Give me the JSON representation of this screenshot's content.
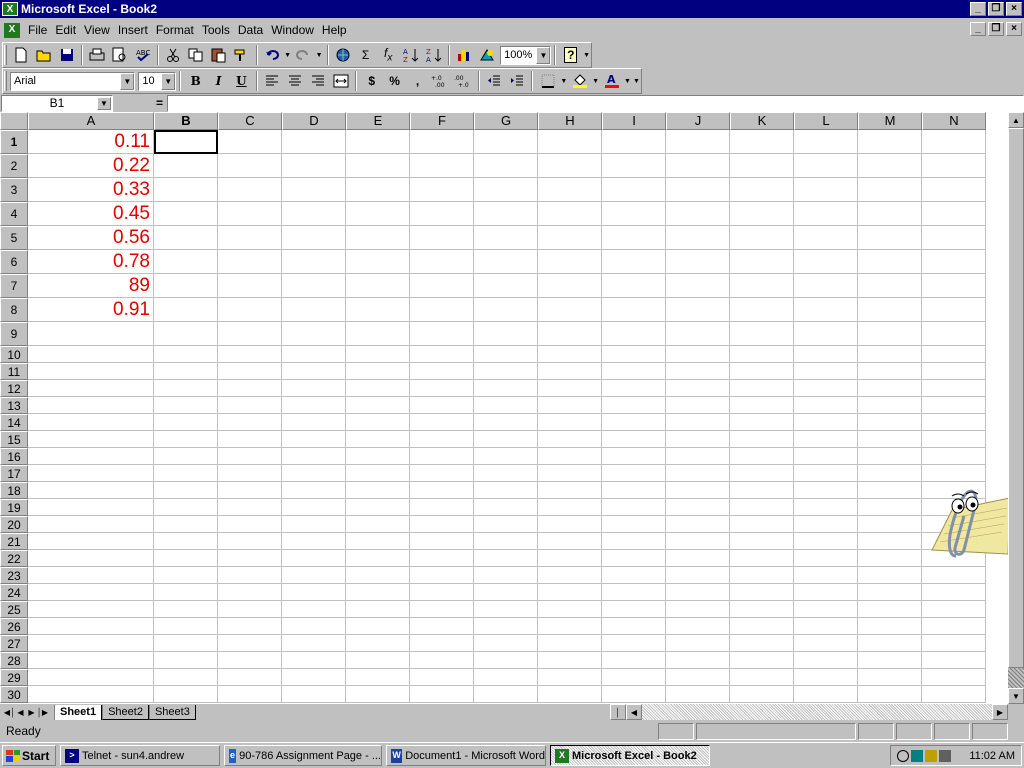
{
  "window": {
    "title": "Microsoft Excel - Book2",
    "buttons": [
      "_",
      "❏",
      "×"
    ]
  },
  "menu": {
    "items": [
      "File",
      "Edit",
      "View",
      "Insert",
      "Format",
      "Tools",
      "Data",
      "Window",
      "Help"
    ]
  },
  "toolbar": {
    "zoom": "100%",
    "font_name": "Arial",
    "font_size": "10",
    "bold": "B",
    "italic": "I",
    "underline": "U",
    "currency": "$",
    "percent": "%",
    "comma": ",",
    "sum": "Σ",
    "fx": "f",
    "fx_sub": "x",
    "help": "?"
  },
  "formula_bar": {
    "name_box": "B1",
    "equals": "=",
    "value": ""
  },
  "sheet": {
    "columns": [
      "A",
      "B",
      "C",
      "D",
      "E",
      "F",
      "G",
      "H",
      "I",
      "J",
      "K",
      "L",
      "M",
      "N"
    ],
    "active_column": "B",
    "active_row": 1,
    "row_numbers": [
      "1",
      "2",
      "3",
      "4",
      "5",
      "6",
      "7",
      "8",
      "9",
      "10",
      "11",
      "12",
      "13",
      "14",
      "15",
      "16",
      "17",
      "18",
      "19",
      "20",
      "21",
      "22",
      "23",
      "24",
      "25",
      "26",
      "27",
      "28",
      "29",
      "30"
    ],
    "column_a_values": [
      "0.11",
      "0.22",
      "0.33",
      "0.45",
      "0.56",
      "0.78",
      "89",
      "0.91"
    ],
    "value_color": "#e00000"
  },
  "tabs": {
    "sheets": [
      "Sheet1",
      "Sheet2",
      "Sheet3"
    ],
    "active": "Sheet1"
  },
  "status": {
    "text": "Ready"
  },
  "taskbar": {
    "start_label": "Start",
    "tasks": [
      {
        "label": "Telnet - sun4.andrew",
        "icon": "telnet-icon"
      },
      {
        "label": "90-786 Assignment Page - ...",
        "icon": "ie-icon"
      },
      {
        "label": "Document1 - Microsoft Word",
        "icon": "word-icon"
      },
      {
        "label": "Microsoft Excel - Book2",
        "icon": "excel-icon",
        "active": true
      }
    ],
    "clock": "11:02 AM"
  }
}
